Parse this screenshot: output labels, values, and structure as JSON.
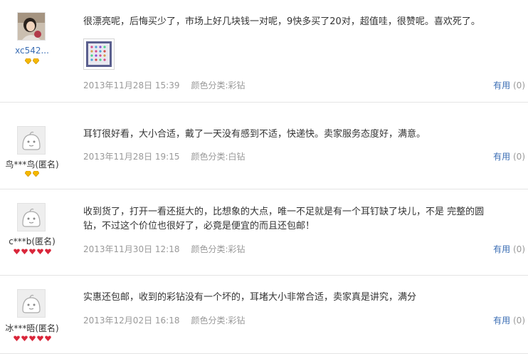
{
  "reviews": [
    {
      "username": "xc542...",
      "text": "很漂亮呢，后悔买少了，市场上好几块钱一对呢，9快多买了20对，超值哇，很赞呢。喜欢死了。",
      "date": "2013年11月28日 15:39",
      "sku": "颜色分类:彩钻",
      "useful_label": "有用",
      "useful_count": "(0)",
      "badge_type": "gold-diamond",
      "badge_count": 2
    },
    {
      "username": "鸟***鸟(匿名)",
      "text": "耳钉很好看，大小合适，戴了一天没有感到不适，快递快。卖家服务态度好，满意。",
      "date": "2013年11月28日 19:15",
      "sku": "颜色分类:白钻",
      "useful_label": "有用",
      "useful_count": "(0)",
      "badge_type": "gold-diamond",
      "badge_count": 2
    },
    {
      "username": "c***b(匿名)",
      "text_line1": "收到货了，打开一看还挺大的，比想象的大点，唯一不足就是有一个耳钉缺了块儿，不是 完整的圆",
      "text_line2": "钻，不过这个价位也很好了，必竟是便宜的而且还包邮！",
      "date": "2013年11月30日 12:18",
      "sku": "颜色分类:彩钻",
      "useful_label": "有用",
      "useful_count": "(0)",
      "badge_type": "red-heart",
      "badge_count": 5
    },
    {
      "username": "冰***晤(匿名)",
      "text": "实惠还包邮，收到的彩钻没有一个坏的，耳堵大小非常合适，卖家真是讲究，满分",
      "date": "2013年12月02日 16:18",
      "sku": "颜色分类:彩钻",
      "useful_label": "有用",
      "useful_count": "(0)",
      "badge_type": "red-heart",
      "badge_count": 5
    }
  ],
  "colors": {
    "link": "#3b6eb4",
    "meta": "#999999",
    "divider": "#e4e4e4",
    "gold": "#f5b800",
    "heart": "#d9263a"
  }
}
